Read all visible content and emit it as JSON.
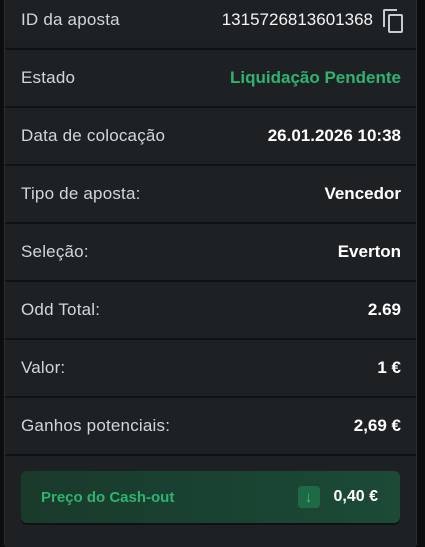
{
  "bet_details": {
    "bet_id": {
      "label": "ID da aposta",
      "value": "1315726813601368"
    },
    "status": {
      "label": "Estado",
      "value": "Liquidação Pendente"
    },
    "placed_date": {
      "label": "Data de colocação",
      "value": "26.01.2026 10:38"
    },
    "bet_type": {
      "label": "Tipo de aposta:",
      "value": "Vencedor"
    },
    "selection": {
      "label": "Seleção:",
      "value": "Everton"
    },
    "total_odds": {
      "label": "Odd Total:",
      "value": "2.69"
    },
    "stake": {
      "label": "Valor:",
      "value": "1 €"
    },
    "potential_winnings": {
      "label": "Ganhos potenciais:",
      "value": "2,69 €"
    }
  },
  "cashout": {
    "label": "Preço do Cash-out",
    "trend_icon": "arrow-down-icon",
    "value": "0,40 €"
  },
  "colors": {
    "background": "#1e2124",
    "accent_green": "#2fb36f",
    "cashout_bg": "#1a3a2c"
  },
  "icons": {
    "copy": "copy-icon"
  }
}
